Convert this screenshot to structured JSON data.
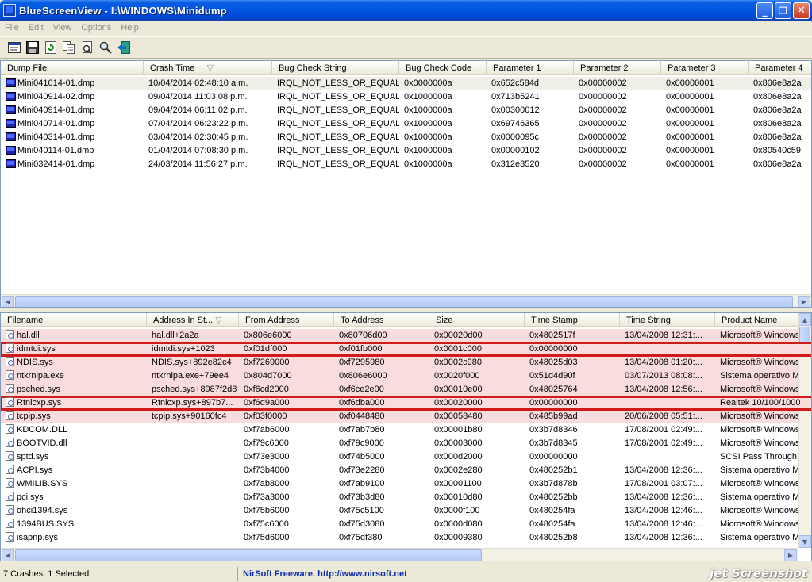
{
  "window": {
    "title": "BlueScreenView  -  I:\\WINDOWS\\Minidump",
    "controls": [
      "_",
      "❐",
      "✕"
    ]
  },
  "menu": [
    "File",
    "Edit",
    "View",
    "Options",
    "Help"
  ],
  "toolbar": [
    "properties-icon",
    "save-icon",
    "refresh-icon",
    "copy-icon",
    "options-icon",
    "find-icon",
    "exit-icon"
  ],
  "dumps": {
    "columns": [
      "Dump File",
      "Crash Time",
      "Bug Check String",
      "Bug Check Code",
      "Parameter 1",
      "Parameter 2",
      "Parameter 3",
      "Parameter 4"
    ],
    "sort_indicator": "▽",
    "rows": [
      {
        "file": "Mini041014-01.dmp",
        "time": "10/04/2014 02:48:10 a.m.",
        "bug": "IRQL_NOT_LESS_OR_EQUAL",
        "code": "0x0000000a",
        "p1": "0x652c584d",
        "p2": "0x00000002",
        "p3": "0x00000001",
        "p4": "0x806e8a2a"
      },
      {
        "file": "Mini040914-02.dmp",
        "time": "09/04/2014 11:03:08 p.m.",
        "bug": "IRQL_NOT_LESS_OR_EQUAL",
        "code": "0x1000000a",
        "p1": "0x713b5241",
        "p2": "0x00000002",
        "p3": "0x00000001",
        "p4": "0x806e8a2a"
      },
      {
        "file": "Mini040914-01.dmp",
        "time": "09/04/2014 06:11:02 p.m.",
        "bug": "IRQL_NOT_LESS_OR_EQUAL",
        "code": "0x1000000a",
        "p1": "0x00300012",
        "p2": "0x00000002",
        "p3": "0x00000001",
        "p4": "0x806e8a2a"
      },
      {
        "file": "Mini040714-01.dmp",
        "time": "07/04/2014 06:23:22 p.m.",
        "bug": "IRQL_NOT_LESS_OR_EQUAL",
        "code": "0x1000000a",
        "p1": "0x69746365",
        "p2": "0x00000002",
        "p3": "0x00000001",
        "p4": "0x806e8a2a"
      },
      {
        "file": "Mini040314-01.dmp",
        "time": "03/04/2014 02:30:45 p.m.",
        "bug": "IRQL_NOT_LESS_OR_EQUAL",
        "code": "0x1000000a",
        "p1": "0x0000095c",
        "p2": "0x00000002",
        "p3": "0x00000001",
        "p4": "0x806e8a2a"
      },
      {
        "file": "Mini040114-01.dmp",
        "time": "01/04/2014 07:08:30 p.m.",
        "bug": "IRQL_NOT_LESS_OR_EQUAL",
        "code": "0x1000000a",
        "p1": "0x00000102",
        "p2": "0x00000002",
        "p3": "0x00000001",
        "p4": "0x80540c59"
      },
      {
        "file": "Mini032414-01.dmp",
        "time": "24/03/2014 11:56:27 p.m.",
        "bug": "IRQL_NOT_LESS_OR_EQUAL",
        "code": "0x1000000a",
        "p1": "0x312e3520",
        "p2": "0x00000002",
        "p3": "0x00000001",
        "p4": "0x806e8a2a"
      }
    ]
  },
  "drivers": {
    "columns": [
      "Filename",
      "Address In St...",
      "From Address",
      "To Address",
      "Size",
      "Time Stamp",
      "Time String",
      "Product Name"
    ],
    "sort_indicator": "▽",
    "rows": [
      {
        "name": "hal.dll",
        "addr": "hal.dll+2a2a",
        "from": "0x806e6000",
        "to": "0x80706d00",
        "size": "0x00020d00",
        "stamp": "0x4802517f",
        "tstr": "13/04/2008 12:31:...",
        "product": "Microsoft® Windows",
        "pink": true,
        "box": false
      },
      {
        "name": "idmtdi.sys",
        "addr": "idmtdi.sys+1023",
        "from": "0xf01df000",
        "to": "0xf01fb000",
        "size": "0x0001c000",
        "stamp": "0x00000000",
        "tstr": "",
        "product": "",
        "pink": true,
        "box": true
      },
      {
        "name": "NDIS.sys",
        "addr": "NDIS.sys+892e82c4",
        "from": "0xf7269000",
        "to": "0xf7295980",
        "size": "0x0002c980",
        "stamp": "0x48025d03",
        "tstr": "13/04/2008 01:20:...",
        "product": "Microsoft® Windows",
        "pink": true,
        "box": false
      },
      {
        "name": "ntkrnlpa.exe",
        "addr": "ntkrnlpa.exe+79ee4",
        "from": "0x804d7000",
        "to": "0x806e6000",
        "size": "0x0020f000",
        "stamp": "0x51d4d90f",
        "tstr": "03/07/2013 08:08:...",
        "product": "Sistema operativo Mi",
        "pink": true,
        "box": false
      },
      {
        "name": "psched.sys",
        "addr": "psched.sys+8987f2d8",
        "from": "0xf6cd2000",
        "to": "0xf6ce2e00",
        "size": "0x00010e00",
        "stamp": "0x48025764",
        "tstr": "13/04/2008 12:56:...",
        "product": "Microsoft® Windows",
        "pink": true,
        "box": false
      },
      {
        "name": "Rtnicxp.sys",
        "addr": "Rtnicxp.sys+897b7...",
        "from": "0xf6d9a000",
        "to": "0xf6dba000",
        "size": "0x00020000",
        "stamp": "0x00000000",
        "tstr": "",
        "product": "Realtek 10/100/1000",
        "pink": true,
        "box": true
      },
      {
        "name": "tcpip.sys",
        "addr": "tcpip.sys+90160fc4",
        "from": "0xf03f0000",
        "to": "0xf0448480",
        "size": "0x00058480",
        "stamp": "0x485b99ad",
        "tstr": "20/06/2008 05:51:...",
        "product": "Microsoft® Windows",
        "pink": true,
        "box": false
      },
      {
        "name": "KDCOM.DLL",
        "addr": "",
        "from": "0xf7ab6000",
        "to": "0xf7ab7b80",
        "size": "0x00001b80",
        "stamp": "0x3b7d8346",
        "tstr": "17/08/2001 02:49:...",
        "product": "Microsoft® Windows",
        "pink": false,
        "box": false
      },
      {
        "name": "BOOTVID.dll",
        "addr": "",
        "from": "0xf79c6000",
        "to": "0xf79c9000",
        "size": "0x00003000",
        "stamp": "0x3b7d8345",
        "tstr": "17/08/2001 02:49:...",
        "product": "Microsoft® Windows",
        "pink": false,
        "box": false
      },
      {
        "name": "sptd.sys",
        "addr": "",
        "from": "0xf73e3000",
        "to": "0xf74b5000",
        "size": "0x000d2000",
        "stamp": "0x00000000",
        "tstr": "",
        "product": "SCSI Pass Through D",
        "pink": false,
        "box": false
      },
      {
        "name": "ACPI.sys",
        "addr": "",
        "from": "0xf73b4000",
        "to": "0xf73e2280",
        "size": "0x0002e280",
        "stamp": "0x480252b1",
        "tstr": "13/04/2008 12:36:...",
        "product": "Sistema operativo Mi",
        "pink": false,
        "box": false
      },
      {
        "name": "WMILIB.SYS",
        "addr": "",
        "from": "0xf7ab8000",
        "to": "0xf7ab9100",
        "size": "0x00001100",
        "stamp": "0x3b7d878b",
        "tstr": "17/08/2001 03:07:...",
        "product": "Microsoft® Windows",
        "pink": false,
        "box": false
      },
      {
        "name": "pci.sys",
        "addr": "",
        "from": "0xf73a3000",
        "to": "0xf73b3d80",
        "size": "0x00010d80",
        "stamp": "0x480252bb",
        "tstr": "13/04/2008 12:36:...",
        "product": "Sistema operativo Mi",
        "pink": false,
        "box": false
      },
      {
        "name": "ohci1394.sys",
        "addr": "",
        "from": "0xf75b6000",
        "to": "0xf75c5100",
        "size": "0x0000f100",
        "stamp": "0x480254fa",
        "tstr": "13/04/2008 12:46:...",
        "product": "Microsoft® Windows",
        "pink": false,
        "box": false
      },
      {
        "name": "1394BUS.SYS",
        "addr": "",
        "from": "0xf75c6000",
        "to": "0xf75d3080",
        "size": "0x0000d080",
        "stamp": "0x480254fa",
        "tstr": "13/04/2008 12:46:...",
        "product": "Microsoft® Windows",
        "pink": false,
        "box": false
      },
      {
        "name": "isapnp.sys",
        "addr": "",
        "from": "0xf75d6000",
        "to": "0xf75df380",
        "size": "0x00009380",
        "stamp": "0x480252b8",
        "tstr": "13/04/2008 12:36:...",
        "product": "Sistema operativo Mi",
        "pink": false,
        "box": false
      }
    ]
  },
  "status": {
    "summary": "7 Crashes, 1 Selected",
    "link": "NirSoft Freeware.  http://www.nirsoft.net"
  },
  "watermark": "jet Screenshot",
  "colors": {
    "highlight_pink": "#f9dcdc",
    "annotation_red": "#d11a1a",
    "link_blue": "#0a2bb0"
  }
}
